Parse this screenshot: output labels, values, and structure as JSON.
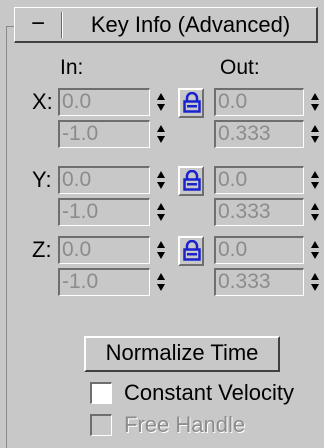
{
  "rollout": {
    "title": "Key Info (Advanced)",
    "collapse_symbol": "−"
  },
  "columns": {
    "in_label": "In:",
    "out_label": "Out:"
  },
  "axes": [
    {
      "label": "X:",
      "in_value": "0.0",
      "in_weight": "-1.0",
      "out_value": "0.0",
      "out_weight": "0.333",
      "locked": true
    },
    {
      "label": "Y:",
      "in_value": "0.0",
      "in_weight": "-1.0",
      "out_value": "0.0",
      "out_weight": "0.333",
      "locked": true
    },
    {
      "label": "Z:",
      "in_value": "0.0",
      "in_weight": "-1.0",
      "out_value": "0.0",
      "out_weight": "0.333",
      "locked": true
    }
  ],
  "normalize_button": "Normalize Time",
  "constant_velocity": {
    "label": "Constant Velocity",
    "checked": false,
    "enabled": true
  },
  "free_handle": {
    "label": "Free Handle",
    "checked": false,
    "enabled": false
  },
  "colors": {
    "panel_bg": "#c8c8c8",
    "lock_blue": "#1a22d0",
    "disabled_text": "#8c8c8c"
  },
  "icons": {
    "spinner": "spinner-arrows-icon",
    "lock": "padlock-icon"
  }
}
